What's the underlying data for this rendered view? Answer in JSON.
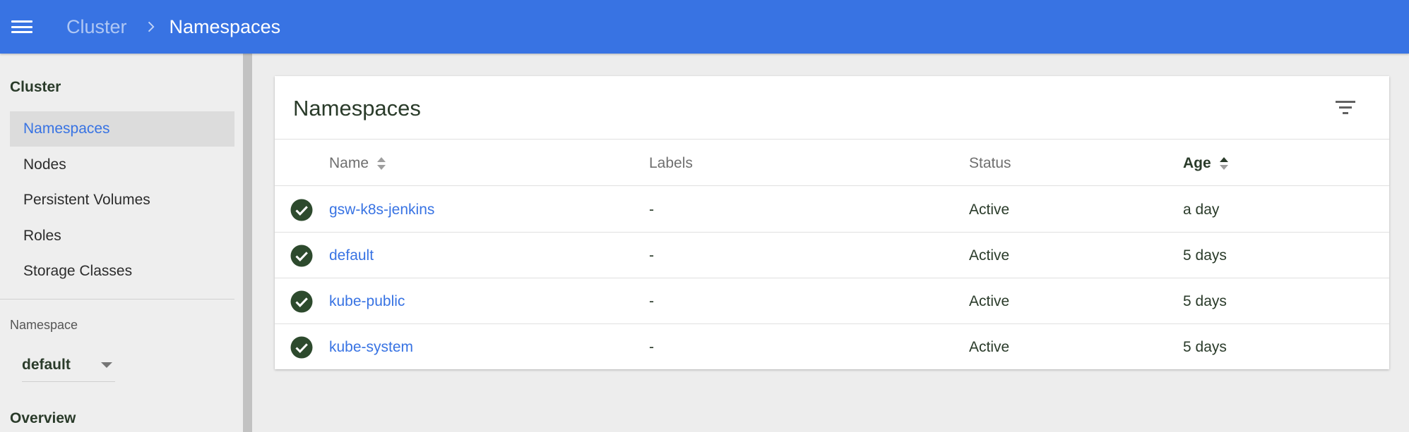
{
  "topbar": {
    "menu_icon": "hamburger-menu-icon",
    "breadcrumb_root": "Cluster",
    "breadcrumb_separator_icon": "chevron-right-icon",
    "breadcrumb_current": "Namespaces",
    "color": "#3873e3"
  },
  "sidebar": {
    "section_title": "Cluster",
    "items": [
      {
        "label": "Namespaces",
        "active": true
      },
      {
        "label": "Nodes",
        "active": false
      },
      {
        "label": "Persistent Volumes",
        "active": false
      },
      {
        "label": "Roles",
        "active": false
      },
      {
        "label": "Storage Classes",
        "active": false
      }
    ],
    "namespace_label": "Namespace",
    "namespace_selected": "default",
    "overview_title": "Overview"
  },
  "card": {
    "title": "Namespaces",
    "filter_icon": "filter-icon",
    "columns": [
      {
        "label": "Name",
        "sortable": true,
        "active": false
      },
      {
        "label": "Labels",
        "sortable": false,
        "active": false
      },
      {
        "label": "Status",
        "sortable": false,
        "active": false
      },
      {
        "label": "Age",
        "sortable": true,
        "active": true
      }
    ],
    "rows": [
      {
        "status_icon": "check-circle-icon",
        "name": "gsw-k8s-jenkins",
        "labels": "-",
        "status": "Active",
        "age": "a day"
      },
      {
        "status_icon": "check-circle-icon",
        "name": "default",
        "labels": "-",
        "status": "Active",
        "age": "5 days"
      },
      {
        "status_icon": "check-circle-icon",
        "name": "kube-public",
        "labels": "-",
        "status": "Active",
        "age": "5 days"
      },
      {
        "status_icon": "check-circle-icon",
        "name": "kube-system",
        "labels": "-",
        "status": "Active",
        "age": "5 days"
      }
    ]
  },
  "colors": {
    "accent": "#3873e3",
    "status_ok": "#2d4a2d"
  }
}
